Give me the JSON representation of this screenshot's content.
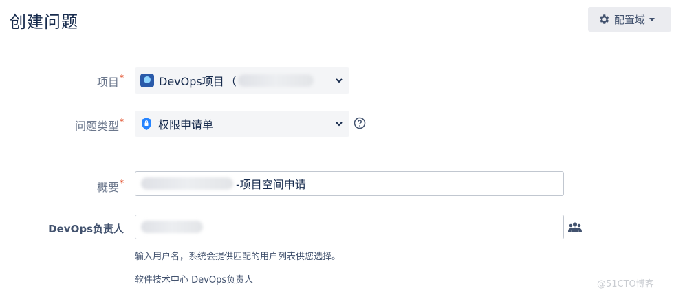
{
  "header": {
    "title": "创建问题",
    "config_label": "配置域"
  },
  "form": {
    "project": {
      "label": "项目",
      "required_mark": "*",
      "value": "DevOps项目",
      "open_paren": "（",
      "icon": "project-avatar-icon"
    },
    "issue_type": {
      "label": "问题类型",
      "required_mark": "*",
      "value": "权限申请单",
      "icon": "shield-icon"
    },
    "summary": {
      "label": "概要",
      "required_mark": "*",
      "value_suffix": "-项目空间申请"
    },
    "devops_owner": {
      "label": "DevOps负责人",
      "hint": "输入用户名，系统会提供匹配的用户列表供您选择。",
      "description": "软件技术中心 DevOps负责人"
    }
  },
  "watermark": "@51CTO博客",
  "colors": {
    "required": "#de350b",
    "button_bg": "#ebecf0",
    "select_bg": "#f4f5f7"
  }
}
